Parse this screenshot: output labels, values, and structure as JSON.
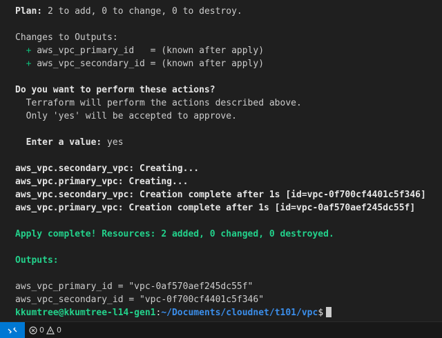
{
  "terminal": {
    "plan_label": "Plan:",
    "plan_text": " 2 to add, 0 to change, 0 to destroy.",
    "changes_header": "Changes to Outputs:",
    "outputs_changes": [
      {
        "sign": "+",
        "text": " aws_vpc_primary_id   = (known after apply)"
      },
      {
        "sign": "+",
        "text": " aws_vpc_secondary_id = (known after apply)"
      }
    ],
    "question": "Do you want to perform these actions?",
    "info_line1": "  Terraform will perform the actions described above.",
    "info_line2": "  Only 'yes' will be accepted to approve.",
    "enter_label": "  Enter a value:",
    "enter_value": " yes",
    "creating": [
      "aws_vpc.secondary_vpc: Creating...",
      "aws_vpc.primary_vpc: Creating...",
      "aws_vpc.secondary_vpc: Creation complete after 1s [id=vpc-0f700cf4401c5f346]",
      "aws_vpc.primary_vpc: Creation complete after 1s [id=vpc-0af570aef245dc55f]"
    ],
    "apply_complete": "Apply complete! Resources: 2 added, 0 changed, 0 destroyed.",
    "outputs_header": "Outputs:",
    "outputs": [
      "aws_vpc_primary_id = \"vpc-0af570aef245dc55f\"",
      "aws_vpc_secondary_id = \"vpc-0f700cf4401c5f346\""
    ],
    "prompt_user": "kkumtree@kkumtree-l14-gen1",
    "prompt_sep": ":",
    "prompt_path": "~/Documents/cloudnet/t101/vpc",
    "prompt_dollar": "$"
  },
  "statusbar": {
    "remote_icon": "remote-icon",
    "errors": "0",
    "warnings": "0"
  },
  "colors": {
    "background": "#1f1f1f",
    "green": "#23d18b",
    "blue": "#3b8eea",
    "accent": "#0078d4"
  }
}
